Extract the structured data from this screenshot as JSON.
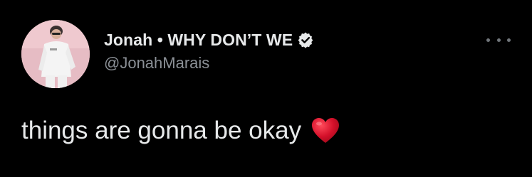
{
  "author": {
    "display_name": "Jonah • WHY DON’T WE",
    "handle": "@JonahMarais",
    "verified": true,
    "avatar_icon": "profile-photo"
  },
  "tweet": {
    "text": "things are gonna be okay",
    "emoji": "heart-emoji"
  },
  "menu": {
    "icon": "more-horizontal-icon"
  },
  "colors": {
    "background": "#000000",
    "text_primary": "#e7e9ea",
    "text_secondary": "#8b9096",
    "heart": "#d4102a"
  }
}
